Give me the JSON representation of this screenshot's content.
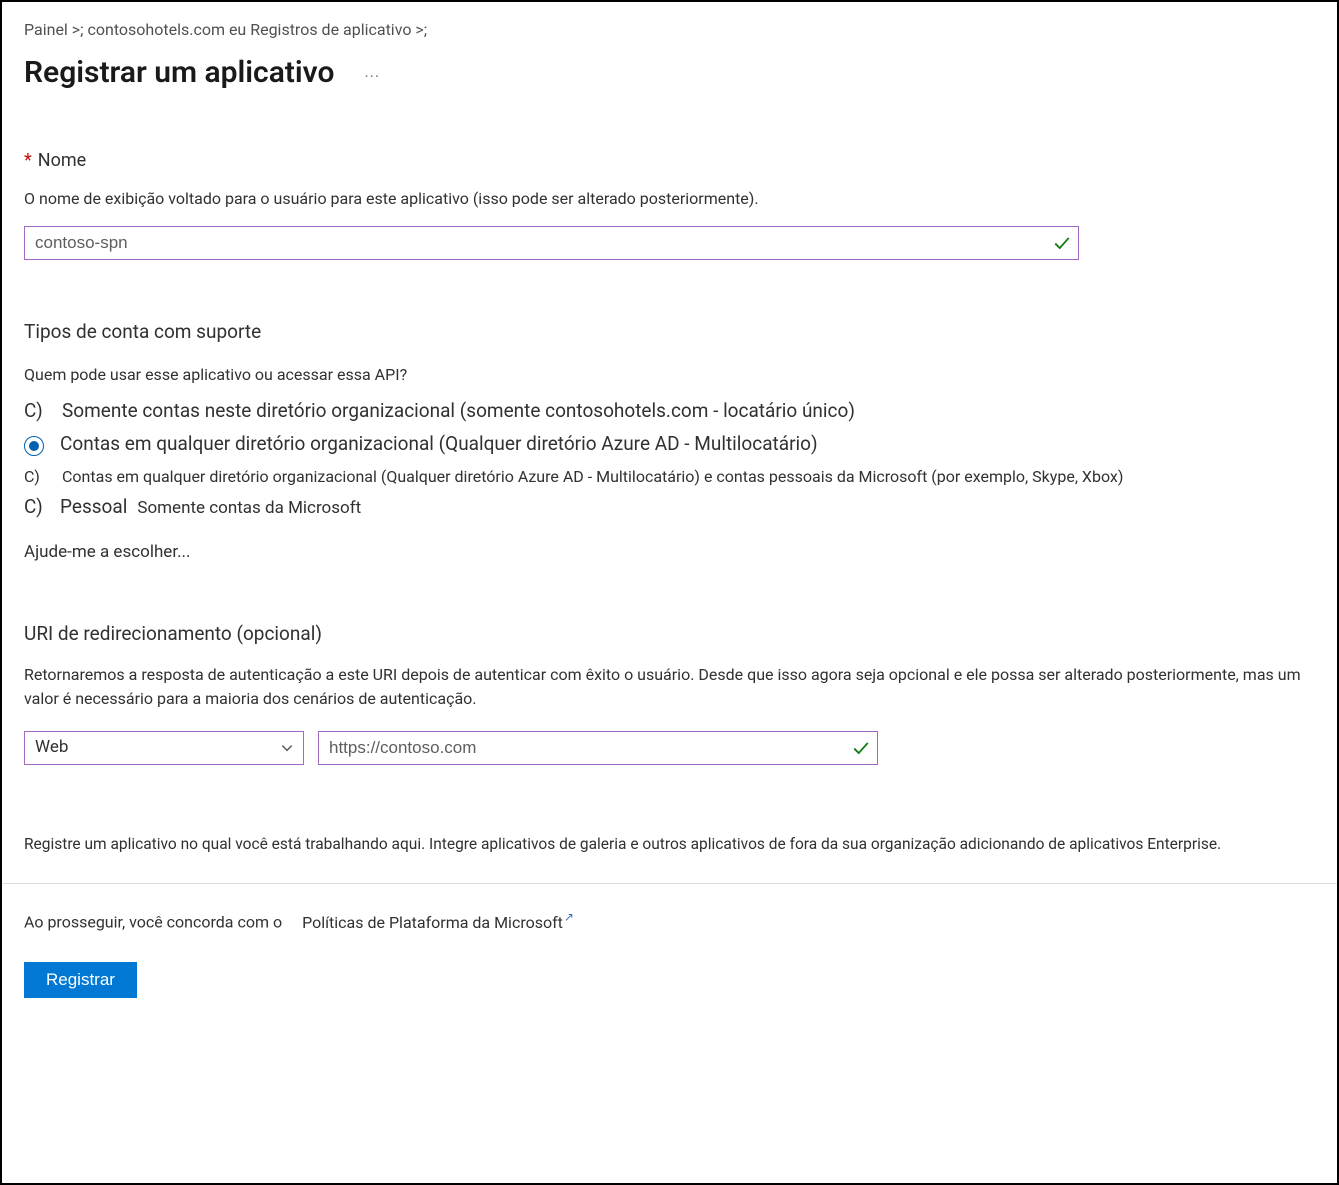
{
  "breadcrumb": {
    "part1": "Painel >;",
    "part2": "contosohotels.com eu Registros de aplicativo >;"
  },
  "page": {
    "title": "Registrar um aplicativo",
    "more": "···"
  },
  "name_section": {
    "label": "Nome",
    "help": "O nome de exibição voltado para o usuário para este aplicativo (isso pode ser alterado posteriormente).",
    "value": "contoso-spn"
  },
  "accounts": {
    "heading": "Tipos de conta com suporte",
    "question": "Quem pode usar esse aplicativo ou acessar essa API?",
    "opt1_prefix": "C)",
    "opt1_label": "Somente contas neste diretório organizacional (somente contosohotels.com - locatário único)",
    "opt2_label": "Contas em qualquer diretório organizacional (Qualquer diretório Azure AD - Multilocatário)",
    "opt3_prefix": "C)",
    "opt3_label": "Contas em qualquer diretório organizacional (Qualquer diretório Azure AD - Multilocatário) e contas pessoais da Microsoft (por exemplo, Skype, Xbox)",
    "opt4_prefix": "C)",
    "opt4_label": "Pessoal",
    "opt4_sub": "Somente contas da Microsoft",
    "help_link": "Ajude-me a escolher..."
  },
  "redirect": {
    "heading": "URI de redirecionamento (opcional)",
    "help": "Retornaremos a resposta de autenticação a este URI depois de autenticar com êxito o usuário. Desde que isso agora seja opcional e ele possa ser alterado posteriormente, mas um valor é necessário para a maioria dos cenários de autenticação.",
    "platform": "Web",
    "uri": "https://contoso.com"
  },
  "enterprise_note": "Registre um aplicativo no qual você está trabalhando aqui. Integre aplicativos de galeria e outros aplicativos de fora da sua organização adicionando de aplicativos Enterprise.",
  "consent": {
    "prefix": "Ao prosseguir, você concorda com o",
    "policy": "Políticas de Plataforma da Microsoft"
  },
  "register_button": "Registrar"
}
